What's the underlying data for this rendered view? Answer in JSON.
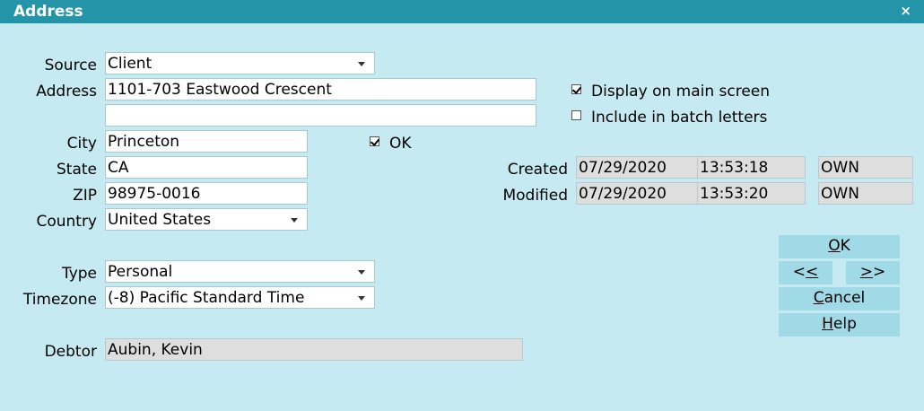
{
  "window": {
    "title": "Address",
    "close_glyph": "×"
  },
  "labels": {
    "source": "Source",
    "address": "Address",
    "city": "City",
    "state": "State",
    "zip": "ZIP",
    "country": "Country",
    "type": "Type",
    "timezone": "Timezone",
    "debtor": "Debtor",
    "created": "Created",
    "modified": "Modified"
  },
  "fields": {
    "source": "Client",
    "address_line1": "1101-703 Eastwood Crescent",
    "address_line2": "",
    "city": "Princeton",
    "state": "CA",
    "zip": "98975-0016",
    "country": "United States",
    "type": "Personal",
    "timezone": "(-8) Pacific Standard Time",
    "debtor": "Aubin, Kevin"
  },
  "checkboxes": {
    "display_main": {
      "label": "Display on main screen",
      "checked": true
    },
    "batch_letters": {
      "label": "Include in batch letters",
      "checked": false
    },
    "ok": {
      "label": "OK",
      "checked": true
    }
  },
  "audit": {
    "created": {
      "date": "07/29/2020",
      "time": "13:53:18",
      "user": "OWN"
    },
    "modified": {
      "date": "07/29/2020",
      "time": "13:53:20",
      "user": "OWN"
    }
  },
  "buttons": {
    "ok": {
      "pre": "",
      "mn": "O",
      "post": "K"
    },
    "prev": {
      "pre": "<",
      "mn": "<",
      "post": ""
    },
    "next": {
      "pre": "",
      "mn": ">",
      "post": ">"
    },
    "cancel": {
      "pre": "",
      "mn": "C",
      "post": "ancel"
    },
    "help": {
      "pre": "",
      "mn": "H",
      "post": "elp"
    }
  },
  "colors": {
    "titlebar": "#2494a8",
    "background": "#c6eaf1",
    "button": "#9fdae6"
  }
}
